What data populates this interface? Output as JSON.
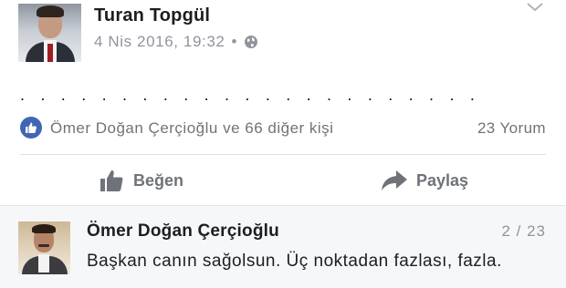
{
  "post": {
    "author": "Turan Topgül",
    "date": "4 Nis 2016, 19:32",
    "separator": "•",
    "privacy_icon": "globe-icon",
    "options_icon": "chevron-down-icon",
    "content": ". . . . . . . . . . . . . . . . . . . . . . .",
    "reactions": {
      "icon": "like-reaction-icon",
      "text": "Ömer Doğan Çerçioğlu ve 66 diğer kişi"
    },
    "comment_count": "23 Yorum",
    "actions": {
      "like_label": "Beğen",
      "like_icon": "thumbs-up-icon",
      "share_label": "Paylaş",
      "share_icon": "share-arrow-icon"
    }
  },
  "comment": {
    "author": "Ömer Doğan Çerçioğlu",
    "pagination": "2 / 23",
    "text": "Başkan canın sağolsun. Üç noktadan fazlası, fazla."
  },
  "colors": {
    "brand": "#4267b2",
    "text_primary": "#1c1e21",
    "text_secondary": "#90949c",
    "divider": "#dcdfe4",
    "comment_background": "#f6f7f9"
  }
}
